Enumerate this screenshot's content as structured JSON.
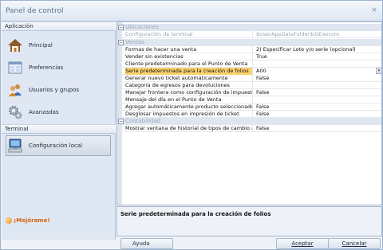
{
  "window": {
    "title": "Panel de control",
    "close": "×"
  },
  "sidebar": {
    "section1": "Aplicación",
    "items": [
      {
        "label": "Principal",
        "icon": "house-icon"
      },
      {
        "label": "Preferencias",
        "icon": "window-icon"
      },
      {
        "label": "Usuarios y grupos",
        "icon": "users-icon"
      },
      {
        "label": "Avanzadas",
        "icon": "gears-icon"
      }
    ],
    "section2": "Terminal",
    "terminal_items": [
      {
        "label": "Configuración local",
        "icon": "computer-icon"
      }
    ],
    "improve_link": "¡Mejórame!"
  },
  "grid": {
    "categories": [
      {
        "label": "Ubicaciones"
      },
      {
        "label": "Ventas"
      },
      {
        "label": "Contabilidad"
      }
    ],
    "ubicaciones": [
      {
        "name": "Configuración de terminal",
        "value": "$UserAppDataFolder$\\GExecom"
      }
    ],
    "ventas": [
      {
        "name": "Formas de hacer una venta",
        "value": "2) Especificar Lote y/o serie (opcional)"
      },
      {
        "name": "Vender sin existencias",
        "value": "True"
      },
      {
        "name": "Cliente predeterminado para el Punto de Venta",
        "value": ""
      },
      {
        "name": "Serie predeterminada para la creación de folios",
        "value": "A00"
      },
      {
        "name": "Generar nuevo ticket automáticamente",
        "value": "False"
      },
      {
        "name": "Categoría de egresos para devoluciones",
        "value": ""
      },
      {
        "name": "Manejar frontera como configuración de impuestos pre",
        "value": "False"
      },
      {
        "name": "Mensaje del día en el Punto de Venta",
        "value": ""
      },
      {
        "name": "Agregar automáticamente producto seleccionado en e",
        "value": "False"
      },
      {
        "name": "Desglosar impuestos en impresión de ticket",
        "value": "False"
      }
    ],
    "contabilidad": [
      {
        "name": "Mostrar ventana de historial de tipos de cambio al inici",
        "value": "False"
      }
    ]
  },
  "description": {
    "title": "Serie predeterminada para la creación de folios"
  },
  "buttons": {
    "help": "Ayuda",
    "accept": "Aceptar",
    "cancel": "Cancelar"
  }
}
